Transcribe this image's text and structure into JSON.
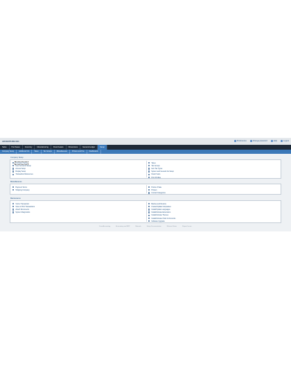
{
  "company_name": "ADVENTURE INC",
  "toolbar_links": [
    {
      "label": "Preferences",
      "icon": "preferences-icon"
    },
    {
      "label": "Change password",
      "icon": "key-icon"
    },
    {
      "label": "Help",
      "icon": "help-icon"
    },
    {
      "label": "Logout",
      "icon": "logout-icon"
    }
  ],
  "nav_tabs": [
    "Sales",
    "Purchases",
    "Inventory",
    "Manufacturing",
    "Fixed Assets",
    "Dimensions",
    "General Ledger",
    "Setup"
  ],
  "active_tab": "Setup",
  "sub_tabs": [
    "Company Setup",
    "Additional Info",
    "Taxes",
    "Tax Groups",
    "Miscellaneous",
    "Printers and Pos",
    "Dashboards"
  ],
  "sections": [
    {
      "title": "Company Setup",
      "left": [
        "Company Setup",
        "User Accounts Setup",
        "Access Setup",
        "Display Setup",
        "Transaction References"
      ],
      "right": [
        "Taxes",
        "Tax Groups",
        "Item Tax Types",
        "System and General GL Setup",
        "Fiscal Years",
        "Print Profiles"
      ],
      "selected": "Company Setup"
    },
    {
      "title": "Miscellaneous",
      "left": [
        "Payment Terms",
        "Shipping Company"
      ],
      "right": [
        "Points of Sale",
        "Printers",
        "Contact Categories"
      ]
    },
    {
      "title": "Maintenance",
      "left": [
        "Void a Transaction",
        "View or Print Transactions",
        "Attach Documents",
        "System Diagnostics"
      ],
      "right": [
        "Backup and Restore",
        "Create/Update Companies",
        "Install/Update Languages",
        "Install/Activate Extensions",
        "Install/Activate Themes",
        "Install/Activate Chart of Accounts",
        "Software Upgrade"
      ]
    }
  ],
  "footer_links": [
    "FrontAccounting",
    "Accounting and ERP",
    "Manuals",
    "Setup Documentation",
    "Release Notes",
    "Report Issues"
  ],
  "colors": {
    "nav_bg": "#1e2a38",
    "accent": "#3b78b8",
    "link": "#1d4f80"
  }
}
